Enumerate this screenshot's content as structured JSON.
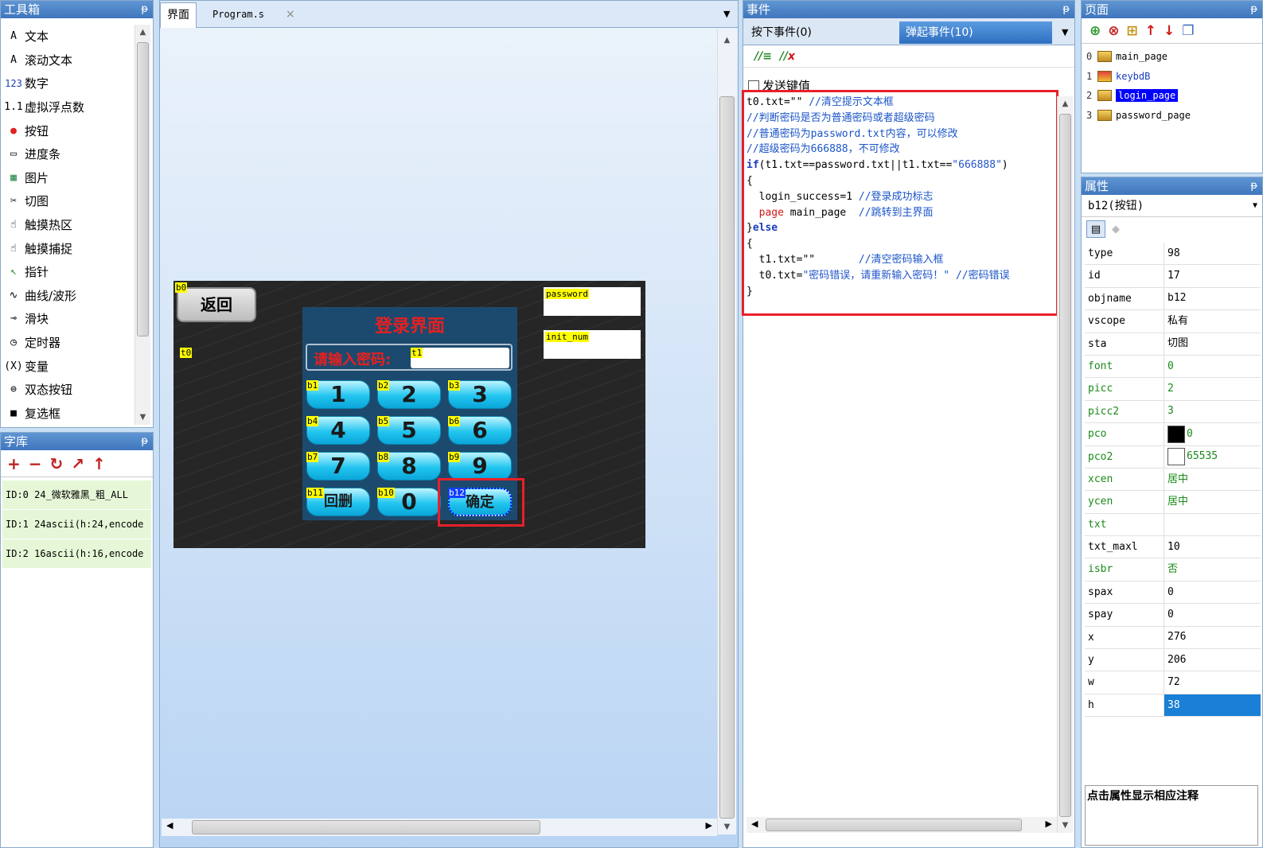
{
  "toolbox": {
    "title": "工具箱",
    "pin": "ᵽ",
    "items": [
      {
        "icon": "A",
        "label": "文本",
        "name": "text"
      },
      {
        "icon": "A",
        "label": "滚动文本",
        "name": "scroll-text"
      },
      {
        "icon": "123",
        "label": "数字",
        "name": "number"
      },
      {
        "icon": "1.1",
        "label": "虚拟浮点数",
        "name": "float"
      },
      {
        "icon": "●",
        "label": "按钮",
        "name": "button"
      },
      {
        "icon": "▭",
        "label": "进度条",
        "name": "progress"
      },
      {
        "icon": "▦",
        "label": "图片",
        "name": "picture"
      },
      {
        "icon": "✂",
        "label": "切图",
        "name": "crop"
      },
      {
        "icon": "☝",
        "label": "触摸热区",
        "name": "hotspot"
      },
      {
        "icon": "☝",
        "label": "触摸捕捉",
        "name": "touch-capture"
      },
      {
        "icon": "↖",
        "label": "指针",
        "name": "pointer"
      },
      {
        "icon": "∿",
        "label": "曲线/波形",
        "name": "waveform"
      },
      {
        "icon": "⊸",
        "label": "滑块",
        "name": "slider"
      },
      {
        "icon": "◷",
        "label": "定时器",
        "name": "timer"
      },
      {
        "icon": "(X)",
        "label": "变量",
        "name": "variable"
      },
      {
        "icon": "⊜",
        "label": "双态按钮",
        "name": "dual-state"
      },
      {
        "icon": "■",
        "label": "复选框",
        "name": "checkbox"
      }
    ]
  },
  "fontlib": {
    "title": "字库",
    "pin": "ᵽ",
    "tools": [
      "+",
      "−",
      "↻",
      "↗",
      "↑"
    ],
    "items": [
      "ID:0  24_微软雅黑_粗_ALL",
      "ID:1  24ascii(h:24,encode",
      "ID:2  16ascii(h:16,encode"
    ]
  },
  "canvas": {
    "tabs": [
      "界面",
      "Program.s"
    ],
    "tab_close": "×",
    "dropdown": "▼",
    "back_label": "返回",
    "title": "登录界面",
    "prompt": "请输入密码:",
    "keys": [
      "1",
      "2",
      "3",
      "4",
      "5",
      "6",
      "7",
      "8",
      "9",
      "回删",
      "0",
      "确定"
    ],
    "key_ids": [
      "b1",
      "b2",
      "b3",
      "b4",
      "b5",
      "b6",
      "b7",
      "b8",
      "b9",
      "b11",
      "b10",
      "b12"
    ],
    "labels": {
      "b0": "b0",
      "t0": "t0",
      "t1": "t1",
      "password": "password",
      "init_num": "init_num"
    }
  },
  "event": {
    "title": "事件",
    "pin": "ᵽ",
    "tab_press": "按下事件(0)",
    "tab_release": "弹起事件(10)",
    "send_key": "发送键值",
    "code": [
      [
        [
          "t0.txt=\"\" ",
          ""
        ],
        [
          "//清空提示文本框",
          "c-cm"
        ]
      ],
      [
        [
          "//判断密码是否为普通密码或者超级密码",
          "c-cm"
        ]
      ],
      [
        [
          "//普通密码为password.txt内容，可以修改",
          "c-cm"
        ]
      ],
      [
        [
          "//超级密码为666888，不可修改",
          "c-cm"
        ]
      ],
      [
        [
          "if",
          "c-kw"
        ],
        [
          "(t1.txt==password.txt||t1.txt==",
          ""
        ],
        [
          "\"666888\"",
          "c-str"
        ],
        [
          ")",
          ""
        ]
      ],
      [
        [
          "{",
          ""
        ]
      ],
      [
        [
          "  login_success=1 ",
          ""
        ],
        [
          "//登录成功标志",
          "c-cm"
        ]
      ],
      [
        [
          "  ",
          ""
        ],
        [
          "page",
          "c-red"
        ],
        [
          " main_page  ",
          ""
        ],
        [
          "//跳转到主界面",
          "c-cm"
        ]
      ],
      [
        [
          "}",
          ""
        ],
        [
          "else",
          "c-kw"
        ]
      ],
      [
        [
          "{",
          ""
        ]
      ],
      [
        [
          "  t1.txt=\"\"       ",
          ""
        ],
        [
          "//清空密码输入框",
          "c-cm"
        ]
      ],
      [
        [
          "  t0.txt=",
          ""
        ],
        [
          "\"密码错误，请重新输入密码！\"",
          "c-str"
        ],
        [
          " ",
          ""
        ],
        [
          "//密码错误",
          "c-cm"
        ]
      ],
      [
        [
          "}",
          ""
        ]
      ]
    ]
  },
  "pages": {
    "title": "页面",
    "pin": "ᵽ",
    "items": [
      {
        "num": "0",
        "name": "main_page"
      },
      {
        "num": "1",
        "name": "keybdB"
      },
      {
        "num": "2",
        "name": "login_page"
      },
      {
        "num": "3",
        "name": "password_page"
      }
    ]
  },
  "props": {
    "title": "属性",
    "pin": "ᵽ",
    "selected": "b12(按钮)",
    "rows": [
      {
        "k": "type",
        "v": "98"
      },
      {
        "k": "id",
        "v": "17"
      },
      {
        "k": "objname",
        "v": "b12"
      },
      {
        "k": "vscope",
        "v": "私有"
      },
      {
        "k": "sta",
        "v": "切图"
      },
      {
        "k": "font",
        "v": "0",
        "green": true
      },
      {
        "k": "picc",
        "v": "2",
        "green": true
      },
      {
        "k": "picc2",
        "v": "3",
        "green": true
      },
      {
        "k": "pco",
        "v": "0",
        "green": true,
        "swatch": "#000000"
      },
      {
        "k": "pco2",
        "v": "65535",
        "green": true,
        "swatch": "#ffffff"
      },
      {
        "k": "xcen",
        "v": "居中",
        "green": true
      },
      {
        "k": "ycen",
        "v": "居中",
        "green": true
      },
      {
        "k": "txt",
        "v": "",
        "green": true
      },
      {
        "k": "txt_maxl",
        "v": "10"
      },
      {
        "k": "isbr",
        "v": "否",
        "green": true
      },
      {
        "k": "spax",
        "v": "0"
      },
      {
        "k": "spay",
        "v": "0"
      },
      {
        "k": "x",
        "v": "276"
      },
      {
        "k": "y",
        "v": "206"
      },
      {
        "k": "w",
        "v": "72"
      },
      {
        "k": "h",
        "v": "38",
        "sel": true
      }
    ],
    "note": "点击属性显示相应注释"
  },
  "colors": {
    "highlight": "#e8202a",
    "selection": "#0000ff",
    "title_bar": "#3f76bd"
  }
}
